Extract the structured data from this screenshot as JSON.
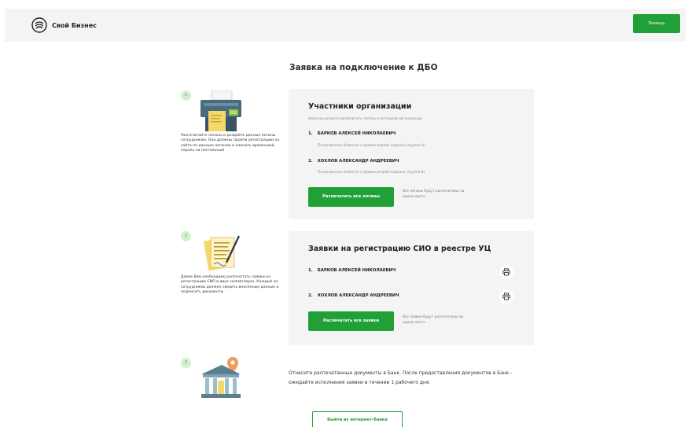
{
  "header": {
    "brand": "Свой Бизнес",
    "help_label": "Помощь"
  },
  "page": {
    "title": "Заявка на подключение к ДБО"
  },
  "steps": [
    {
      "number": "1",
      "text": "Распечатайте логины и раздайте данные логины сотрудникам. Они должны пройти регистрацию на сайте по данным логинам и сменить временный пароль на постоянный"
    },
    {
      "number": "2",
      "text": "Далее Вам необходимо распечатать заявки на регистрацию СИО в двух экземплярах. Каждый из сотрудников должен сверить внесённые данные и подписать документы"
    },
    {
      "number": "3",
      "text": "Отнесите распечатанные документы в Банк. После предоставления документов в Банк - ожидайте исполнения заявки в течении 1 рабочего дня."
    }
  ],
  "participants": {
    "title": "Участники организации",
    "subtitle": "Ниже вы можете распечатать логины участников организации",
    "members": [
      {
        "num": "1.",
        "name": "БАРКОВ АЛЕКСЕЙ НИКОЛАЕВИЧ",
        "role": "Пользователь Клиента с правом первой подписи (группа А)"
      },
      {
        "num": "2.",
        "name": "ХОХЛОВ АЛЕКСАНДР АНДРЕЕВИЧ",
        "role": "Пользователь Клиента с правом второй подписи (группа Б)"
      }
    ],
    "button_label": "Распечатать все логины",
    "note": "Все логины будут распечатаны на одном листе"
  },
  "requests": {
    "title": "Заявки на регистрацию СИО в реестре УЦ",
    "members": [
      {
        "num": "1.",
        "name": "БАРКОВ АЛЕКСЕЙ НИКОЛАЕВИЧ"
      },
      {
        "num": "2.",
        "name": "ХОХЛОВ АЛЕКСАНДР АНДРЕЕВИЧ"
      }
    ],
    "button_label": "Распечатать все заявки",
    "note": "Все заявки будут распечатаны на одном листе"
  },
  "footer": {
    "logout_label": "Выйти из интернет-банка"
  },
  "colors": {
    "accent": "#21a038",
    "card_bg": "#f4f4f4",
    "badge_bg": "#d4efce"
  },
  "icons": {
    "logo": "sber-logo-icon",
    "printer": "printer-icon"
  }
}
